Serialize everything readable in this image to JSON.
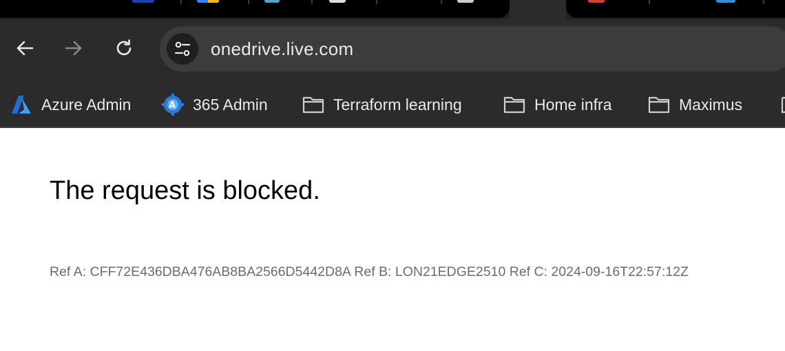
{
  "browser": {
    "address_bar": {
      "url": "onedrive.live.com",
      "site_info_icon": "tune-icon"
    },
    "nav": {
      "back_icon": "arrow-left-icon",
      "forward_icon": "arrow-right-icon",
      "reload_icon": "reload-icon"
    },
    "bookmarks": [
      {
        "label": "Azure Admin",
        "icon": "azure-logo-icon"
      },
      {
        "label": "365 Admin",
        "icon": "admin-gear-icon"
      },
      {
        "label": "Terraform learning",
        "icon": "folder-icon"
      },
      {
        "label": "Home infra",
        "icon": "folder-icon"
      },
      {
        "label": "Maximus",
        "icon": "folder-icon"
      }
    ],
    "colors": {
      "chrome_dark": "#2b2b2b",
      "omnibox": "#3c3c3c",
      "text_light": "#e8eaed"
    }
  },
  "page": {
    "headline": "The request is blocked.",
    "reference": "Ref A: CFF72E436DBA476AB8BA2566D5442D8A Ref B: LON21EDGE2510 Ref C: 2024-09-16T22:57:12Z"
  }
}
